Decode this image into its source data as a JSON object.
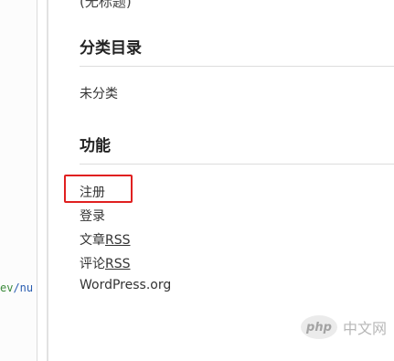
{
  "left_pane": {
    "code_prefix": "ev",
    "code_suffix": "/nu"
  },
  "widgets": {
    "clipped_text": "(无标题)",
    "categories_title": "分类目录",
    "categories": [
      "未分类"
    ],
    "functions_title": "功能",
    "functions": {
      "register": "注册",
      "login": "登录",
      "entries_prefix": "文章",
      "entries_rss": "RSS",
      "comments_prefix": "评论",
      "comments_rss": "RSS",
      "wordpress": "WordPress.org"
    }
  },
  "watermark": {
    "logo": "php",
    "text": "中文网"
  },
  "colors": {
    "highlight": "#e02020",
    "link": "#333333"
  }
}
